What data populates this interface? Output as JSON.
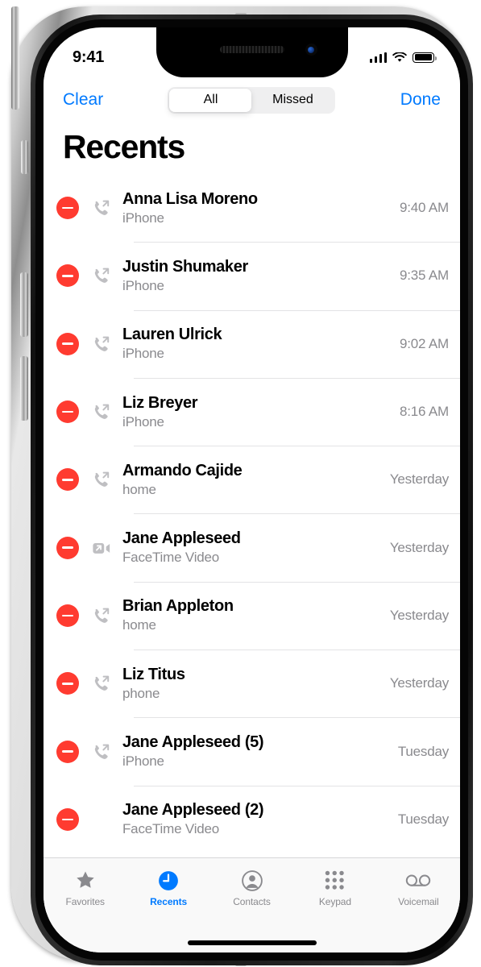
{
  "status_bar": {
    "time": "9:41",
    "signal_icon": "cellular-bars-icon",
    "wifi_icon": "wifi-icon",
    "battery_icon": "battery-icon"
  },
  "nav_bar": {
    "left_button": "Clear",
    "right_button": "Done",
    "segmented_control": {
      "options": [
        "All",
        "Missed"
      ],
      "selected": "All"
    }
  },
  "page_title": "Recents",
  "accent_color": "#007AFF",
  "delete_color": "#FF3B30",
  "calls": [
    {
      "name": "Anna Lisa Moreno",
      "label": "iPhone",
      "time": "9:40 AM",
      "type": "outgoing-call-icon",
      "delete": "delete-button"
    },
    {
      "name": "Justin Shumaker",
      "label": "iPhone",
      "time": "9:35 AM",
      "type": "outgoing-call-icon",
      "delete": "delete-button"
    },
    {
      "name": "Lauren Ulrick",
      "label": "iPhone",
      "time": "9:02 AM",
      "type": "outgoing-call-icon",
      "delete": "delete-button"
    },
    {
      "name": "Liz Breyer",
      "label": "iPhone",
      "time": "8:16 AM",
      "type": "outgoing-call-icon",
      "delete": "delete-button"
    },
    {
      "name": "Armando Cajide",
      "label": "home",
      "time": "Yesterday",
      "type": "outgoing-call-icon",
      "delete": "delete-button"
    },
    {
      "name": "Jane Appleseed",
      "label": "FaceTime Video",
      "time": "Yesterday",
      "type": "outgoing-facetime-video-icon",
      "delete": "delete-button"
    },
    {
      "name": "Brian Appleton",
      "label": "home",
      "time": "Yesterday",
      "type": "outgoing-call-icon",
      "delete": "delete-button"
    },
    {
      "name": "Liz Titus",
      "label": "phone",
      "time": "Yesterday",
      "type": "outgoing-call-icon",
      "delete": "delete-button"
    },
    {
      "name": "Jane Appleseed (5)",
      "label": "iPhone",
      "time": "Tuesday",
      "type": "outgoing-call-icon",
      "delete": "delete-button"
    },
    {
      "name": "Jane Appleseed (2)",
      "label": "FaceTime Video",
      "time": "Tuesday",
      "type": "none",
      "delete": "delete-button"
    }
  ],
  "tab_bar": {
    "items": [
      {
        "label": "Favorites",
        "icon": "star-icon",
        "active": false
      },
      {
        "label": "Recents",
        "icon": "clock-icon",
        "active": true
      },
      {
        "label": "Contacts",
        "icon": "person-icon",
        "active": false
      },
      {
        "label": "Keypad",
        "icon": "keypad-icon",
        "active": false
      },
      {
        "label": "Voicemail",
        "icon": "voicemail-icon",
        "active": false
      }
    ]
  }
}
